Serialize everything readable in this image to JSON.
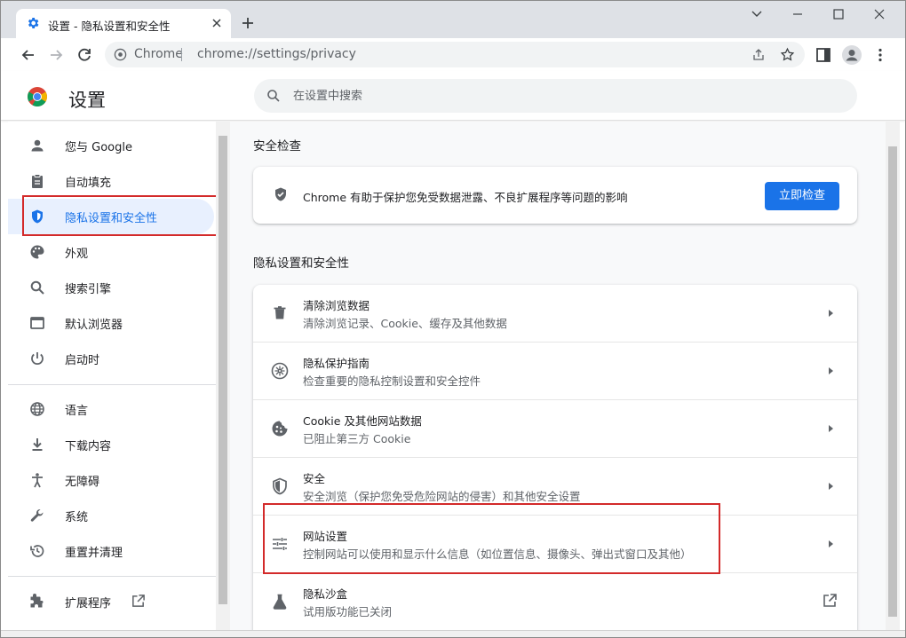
{
  "tab": {
    "title": "设置 - 隐私设置和安全性"
  },
  "toolbar": {
    "site_label": "Chrome",
    "url": "chrome://settings/privacy"
  },
  "header": {
    "title": "设置",
    "search_placeholder": "在设置中搜索"
  },
  "sidebar": {
    "items": [
      {
        "label": "您与 Google",
        "icon": "person-icon"
      },
      {
        "label": "自动填充",
        "icon": "clipboard-icon"
      },
      {
        "label": "隐私设置和安全性",
        "icon": "shield-icon",
        "active": true
      },
      {
        "label": "外观",
        "icon": "palette-icon"
      },
      {
        "label": "搜索引擎",
        "icon": "search-icon"
      },
      {
        "label": "默认浏览器",
        "icon": "browser-icon"
      },
      {
        "label": "启动时",
        "icon": "power-icon"
      },
      {
        "label": "语言",
        "icon": "globe-icon"
      },
      {
        "label": "下载内容",
        "icon": "download-icon"
      },
      {
        "label": "无障碍",
        "icon": "accessibility-icon"
      },
      {
        "label": "系统",
        "icon": "wrench-icon"
      },
      {
        "label": "重置并清理",
        "icon": "history-icon"
      },
      {
        "label": "扩展程序",
        "icon": "puzzle-icon"
      }
    ]
  },
  "safety_check": {
    "section_title": "安全检查",
    "text": "Chrome 有助于保护您免受数据泄露、不良扩展程序等问题的影响",
    "button_label": "立即检查"
  },
  "privacy": {
    "section_title": "隐私设置和安全性",
    "rows": [
      {
        "title": "清除浏览数据",
        "subtitle": "清除浏览记录、Cookie、缓存及其他数据",
        "icon": "trash-icon"
      },
      {
        "title": "隐私保护指南",
        "subtitle": "检查重要的隐私控制设置和安全控件",
        "icon": "compass-icon"
      },
      {
        "title": "Cookie 及其他网站数据",
        "subtitle": "已阻止第三方 Cookie",
        "icon": "cookie-icon"
      },
      {
        "title": "安全",
        "subtitle": "安全浏览（保护您免受危险网站的侵害）和其他安全设置",
        "icon": "shield-icon"
      },
      {
        "title": "网站设置",
        "subtitle": "控制网站可以使用和显示什么信息（如位置信息、摄像头、弹出式窗口及其他）",
        "icon": "tune-icon"
      },
      {
        "title": "隐私沙盒",
        "subtitle": "试用版功能已关闭",
        "icon": "flask-icon"
      }
    ]
  },
  "colors": {
    "accent": "#1a73e8",
    "highlight": "#d32a2a"
  }
}
